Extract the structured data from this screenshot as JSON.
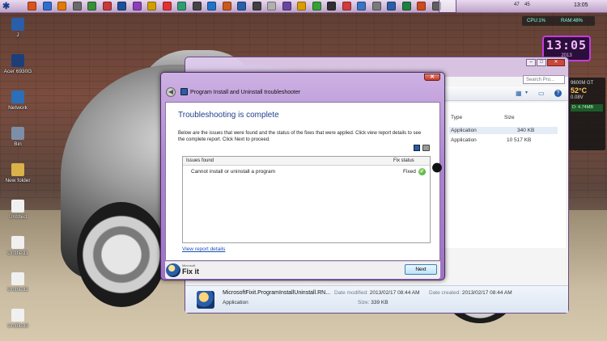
{
  "taskbar": {
    "clock": "13:05",
    "tray_values": [
      "47",
      "45"
    ],
    "icon_colors": [
      "#d8541f",
      "#2f6fd0",
      "#e27b00",
      "#6a6a6a",
      "#3a8f3a",
      "#c63a3a",
      "#1b4f9a",
      "#8c3fb8",
      "#d0a000",
      "#e03232",
      "#2d9e72",
      "#444444",
      "#1f73c8",
      "#c85a1d",
      "#2a5ea8",
      "#404040",
      "#b0b0b0",
      "#6a45a0",
      "#d99d00",
      "#33a133",
      "#303030",
      "#d13b3b",
      "#3a74c4",
      "#7a7a7a",
      "#2a5ea8",
      "#1e7f3e",
      "#cc4b1f",
      "#5f5f5f"
    ]
  },
  "desktop_icons": [
    {
      "label": "J"
    },
    {
      "label": "Acer 6930G"
    },
    {
      "label": "Network"
    },
    {
      "label": "Bin"
    },
    {
      "label": "New folder"
    },
    {
      "label": "Untitled"
    },
    {
      "label": "Untitled1"
    },
    {
      "label": "Untitled2"
    },
    {
      "label": "Untitled3"
    }
  ],
  "gadgets": {
    "cpu": "CPU:1%",
    "ram": "RAM:48%",
    "clock": "13:05",
    "clock_year": "2013",
    "gpu_name": "9600M GT",
    "gpu_temp": "52°C",
    "gpu_clock": "0.08V",
    "gpu_io": "D: 4.74MB"
  },
  "explorer": {
    "search_placeholder": "Search Pro...",
    "col_type": "Type",
    "col_size": "Size",
    "files": [
      {
        "type": "Application",
        "size": "340 KB"
      },
      {
        "type": "Application",
        "size": "10 517 KB"
      }
    ],
    "details": {
      "name": "MicrosoftFixit.ProgramInstallUninstall.RN...",
      "type": "Application",
      "modified_label": "Date modified:",
      "modified": "2013/02/17 08:44 AM",
      "created_label": "Date created:",
      "created": "2013/02/17 08:44 AM",
      "size_label": "Size:",
      "size": "339 KB"
    }
  },
  "dialog": {
    "title": "Program Install and Uninstall troubleshooter",
    "heading": "Troubleshooting is complete",
    "description": "Below are the issues that were found and the status of the fixes that were applied. Click view report details to see the complete report. Click Next to proceed.",
    "issues_header": "Issues found",
    "status_header": "Fix status",
    "issues": [
      {
        "text": "Cannot install or uninstall a program",
        "status": "Fixed"
      }
    ],
    "report_link": "View report details",
    "logo_small": "Microsoft",
    "logo_big": "Fix it",
    "next_button": "Next",
    "close_glyph": "✕",
    "back_glyph": "◀"
  },
  "colors": {
    "accent_purple": "#ad84cf",
    "heading_blue": "#1f3f8c",
    "link_blue": "#1c4fb3",
    "check_green": "#2f9a23"
  }
}
